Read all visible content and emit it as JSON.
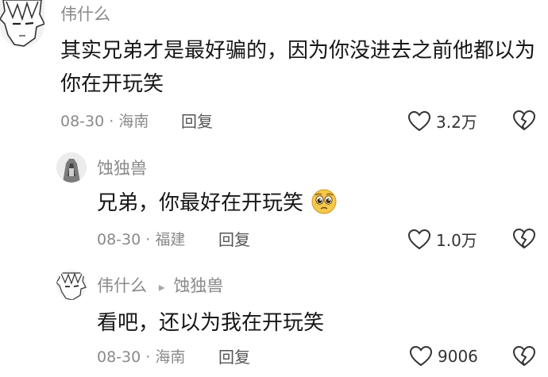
{
  "comment": {
    "author": "伟什么",
    "text": "其实兄弟才是最好骗的，因为你没进去之前他都以为你在开玩笑",
    "date": "08-30",
    "sep": "·",
    "location": "海南",
    "reply_label": "回复",
    "likes": "3.2万"
  },
  "reply1": {
    "author": "蚀独兽",
    "text": "兄弟，你最好在开玩笑",
    "emoji": "pleading-face-emoji",
    "date": "08-30",
    "sep": "·",
    "location": "福建",
    "reply_label": "回复",
    "likes": "1.0万"
  },
  "reply2": {
    "author": "伟什么",
    "reply_to_arrow": "▸",
    "reply_to": "蚀独兽",
    "text": "看吧，还以为我在开玩笑",
    "date": "08-30",
    "sep": "·",
    "location": "海南",
    "reply_label": "回复",
    "likes": "9006"
  },
  "colors": {
    "secondary_text": "#8a8a8a",
    "primary_text": "#161616",
    "icon_stroke": "#333333",
    "emoji_yellow": "#f6c84a"
  }
}
